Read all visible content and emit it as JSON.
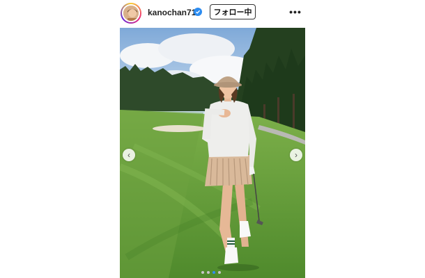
{
  "post_header": {
    "username": "kanochan715",
    "follow_label": "フォロー中",
    "more_label": "•••"
  },
  "photo": {
    "alt_subject": "golf-course-portrait",
    "arrow_left": "‹",
    "arrow_right": "›"
  },
  "carousel": {
    "total": 4,
    "active_index": 2
  },
  "colors": {
    "verified_badge": "#2d8cf0",
    "active_dot": "#2d8cf0",
    "grass": "#5f9a3a",
    "sky": "#a9c6e6"
  }
}
